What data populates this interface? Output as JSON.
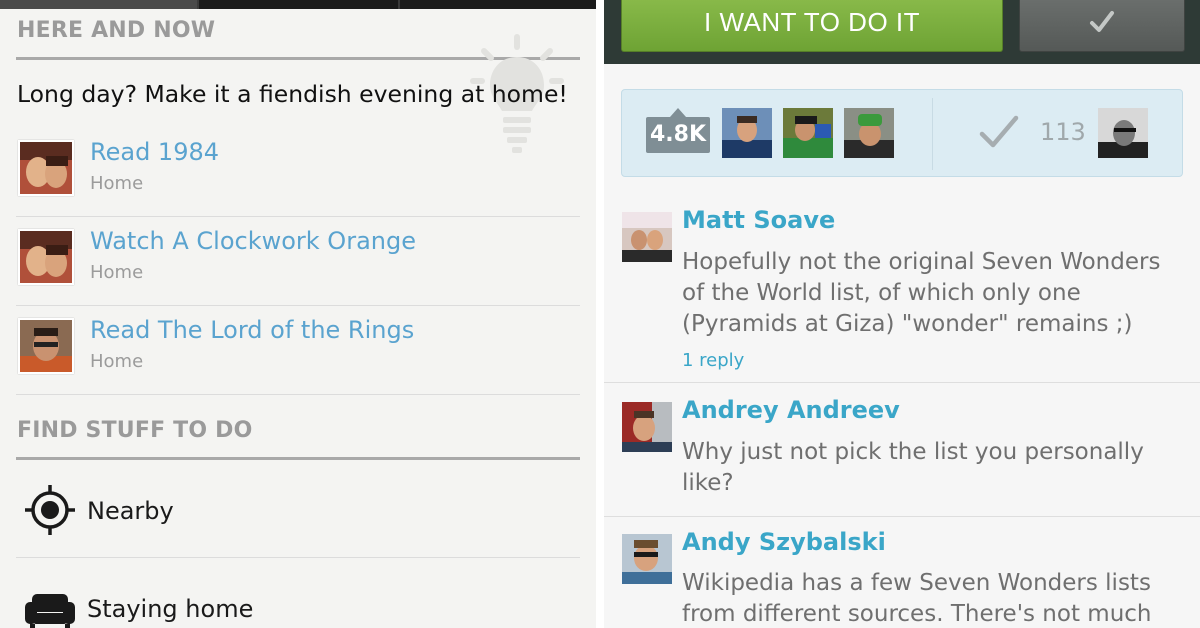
{
  "left": {
    "section_here": "HERE AND NOW",
    "tagline": "Long day? Make it a fiendish evening at home!",
    "todos": [
      {
        "title": "Read 1984",
        "location": "Home"
      },
      {
        "title": "Watch A Clockwork Orange",
        "location": "Home"
      },
      {
        "title": "Read The Lord of the Rings",
        "location": "Home"
      }
    ],
    "section_find": "FIND STUFF TO DO",
    "find_items": [
      {
        "label": "Nearby",
        "icon": "crosshair-icon"
      },
      {
        "label": "Staying home",
        "icon": "sofa-icon"
      }
    ]
  },
  "right": {
    "want_button": "I WANT TO DO IT",
    "done_button_icon": "check-icon",
    "want_count": "4.8K",
    "done_count": "113",
    "comments": [
      {
        "name": "Matt Soave",
        "text": "Hopefully not the original Seven Wonders of the World list, of which only one (Pyramids at Giza) \"wonder\" remains ;)",
        "reply": "1 reply"
      },
      {
        "name": "Andrey Andreev",
        "text": "Why just not pick the list you personally like?"
      },
      {
        "name": "Andy Szybalski",
        "text": "Wikipedia has a few Seven Wonders lists from different sources. There's not much"
      }
    ]
  },
  "colors": {
    "link_blue": "#5aa3cf",
    "name_blue": "#3aa6c8",
    "want_green": "#7aae3d",
    "stats_bg": "#dcecf3"
  }
}
